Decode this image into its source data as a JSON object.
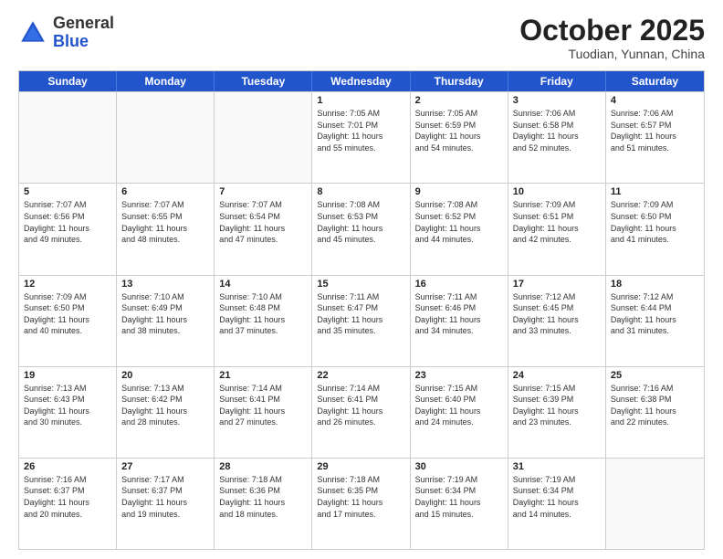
{
  "header": {
    "logo_general": "General",
    "logo_blue": "Blue",
    "month": "October 2025",
    "location": "Tuodian, Yunnan, China"
  },
  "weekdays": [
    "Sunday",
    "Monday",
    "Tuesday",
    "Wednesday",
    "Thursday",
    "Friday",
    "Saturday"
  ],
  "rows": [
    [
      {
        "day": "",
        "text": ""
      },
      {
        "day": "",
        "text": ""
      },
      {
        "day": "",
        "text": ""
      },
      {
        "day": "1",
        "text": "Sunrise: 7:05 AM\nSunset: 7:01 PM\nDaylight: 11 hours\nand 55 minutes."
      },
      {
        "day": "2",
        "text": "Sunrise: 7:05 AM\nSunset: 6:59 PM\nDaylight: 11 hours\nand 54 minutes."
      },
      {
        "day": "3",
        "text": "Sunrise: 7:06 AM\nSunset: 6:58 PM\nDaylight: 11 hours\nand 52 minutes."
      },
      {
        "day": "4",
        "text": "Sunrise: 7:06 AM\nSunset: 6:57 PM\nDaylight: 11 hours\nand 51 minutes."
      }
    ],
    [
      {
        "day": "5",
        "text": "Sunrise: 7:07 AM\nSunset: 6:56 PM\nDaylight: 11 hours\nand 49 minutes."
      },
      {
        "day": "6",
        "text": "Sunrise: 7:07 AM\nSunset: 6:55 PM\nDaylight: 11 hours\nand 48 minutes."
      },
      {
        "day": "7",
        "text": "Sunrise: 7:07 AM\nSunset: 6:54 PM\nDaylight: 11 hours\nand 47 minutes."
      },
      {
        "day": "8",
        "text": "Sunrise: 7:08 AM\nSunset: 6:53 PM\nDaylight: 11 hours\nand 45 minutes."
      },
      {
        "day": "9",
        "text": "Sunrise: 7:08 AM\nSunset: 6:52 PM\nDaylight: 11 hours\nand 44 minutes."
      },
      {
        "day": "10",
        "text": "Sunrise: 7:09 AM\nSunset: 6:51 PM\nDaylight: 11 hours\nand 42 minutes."
      },
      {
        "day": "11",
        "text": "Sunrise: 7:09 AM\nSunset: 6:50 PM\nDaylight: 11 hours\nand 41 minutes."
      }
    ],
    [
      {
        "day": "12",
        "text": "Sunrise: 7:09 AM\nSunset: 6:50 PM\nDaylight: 11 hours\nand 40 minutes."
      },
      {
        "day": "13",
        "text": "Sunrise: 7:10 AM\nSunset: 6:49 PM\nDaylight: 11 hours\nand 38 minutes."
      },
      {
        "day": "14",
        "text": "Sunrise: 7:10 AM\nSunset: 6:48 PM\nDaylight: 11 hours\nand 37 minutes."
      },
      {
        "day": "15",
        "text": "Sunrise: 7:11 AM\nSunset: 6:47 PM\nDaylight: 11 hours\nand 35 minutes."
      },
      {
        "day": "16",
        "text": "Sunrise: 7:11 AM\nSunset: 6:46 PM\nDaylight: 11 hours\nand 34 minutes."
      },
      {
        "day": "17",
        "text": "Sunrise: 7:12 AM\nSunset: 6:45 PM\nDaylight: 11 hours\nand 33 minutes."
      },
      {
        "day": "18",
        "text": "Sunrise: 7:12 AM\nSunset: 6:44 PM\nDaylight: 11 hours\nand 31 minutes."
      }
    ],
    [
      {
        "day": "19",
        "text": "Sunrise: 7:13 AM\nSunset: 6:43 PM\nDaylight: 11 hours\nand 30 minutes."
      },
      {
        "day": "20",
        "text": "Sunrise: 7:13 AM\nSunset: 6:42 PM\nDaylight: 11 hours\nand 28 minutes."
      },
      {
        "day": "21",
        "text": "Sunrise: 7:14 AM\nSunset: 6:41 PM\nDaylight: 11 hours\nand 27 minutes."
      },
      {
        "day": "22",
        "text": "Sunrise: 7:14 AM\nSunset: 6:41 PM\nDaylight: 11 hours\nand 26 minutes."
      },
      {
        "day": "23",
        "text": "Sunrise: 7:15 AM\nSunset: 6:40 PM\nDaylight: 11 hours\nand 24 minutes."
      },
      {
        "day": "24",
        "text": "Sunrise: 7:15 AM\nSunset: 6:39 PM\nDaylight: 11 hours\nand 23 minutes."
      },
      {
        "day": "25",
        "text": "Sunrise: 7:16 AM\nSunset: 6:38 PM\nDaylight: 11 hours\nand 22 minutes."
      }
    ],
    [
      {
        "day": "26",
        "text": "Sunrise: 7:16 AM\nSunset: 6:37 PM\nDaylight: 11 hours\nand 20 minutes."
      },
      {
        "day": "27",
        "text": "Sunrise: 7:17 AM\nSunset: 6:37 PM\nDaylight: 11 hours\nand 19 minutes."
      },
      {
        "day": "28",
        "text": "Sunrise: 7:18 AM\nSunset: 6:36 PM\nDaylight: 11 hours\nand 18 minutes."
      },
      {
        "day": "29",
        "text": "Sunrise: 7:18 AM\nSunset: 6:35 PM\nDaylight: 11 hours\nand 17 minutes."
      },
      {
        "day": "30",
        "text": "Sunrise: 7:19 AM\nSunset: 6:34 PM\nDaylight: 11 hours\nand 15 minutes."
      },
      {
        "day": "31",
        "text": "Sunrise: 7:19 AM\nSunset: 6:34 PM\nDaylight: 11 hours\nand 14 minutes."
      },
      {
        "day": "",
        "text": ""
      }
    ]
  ]
}
